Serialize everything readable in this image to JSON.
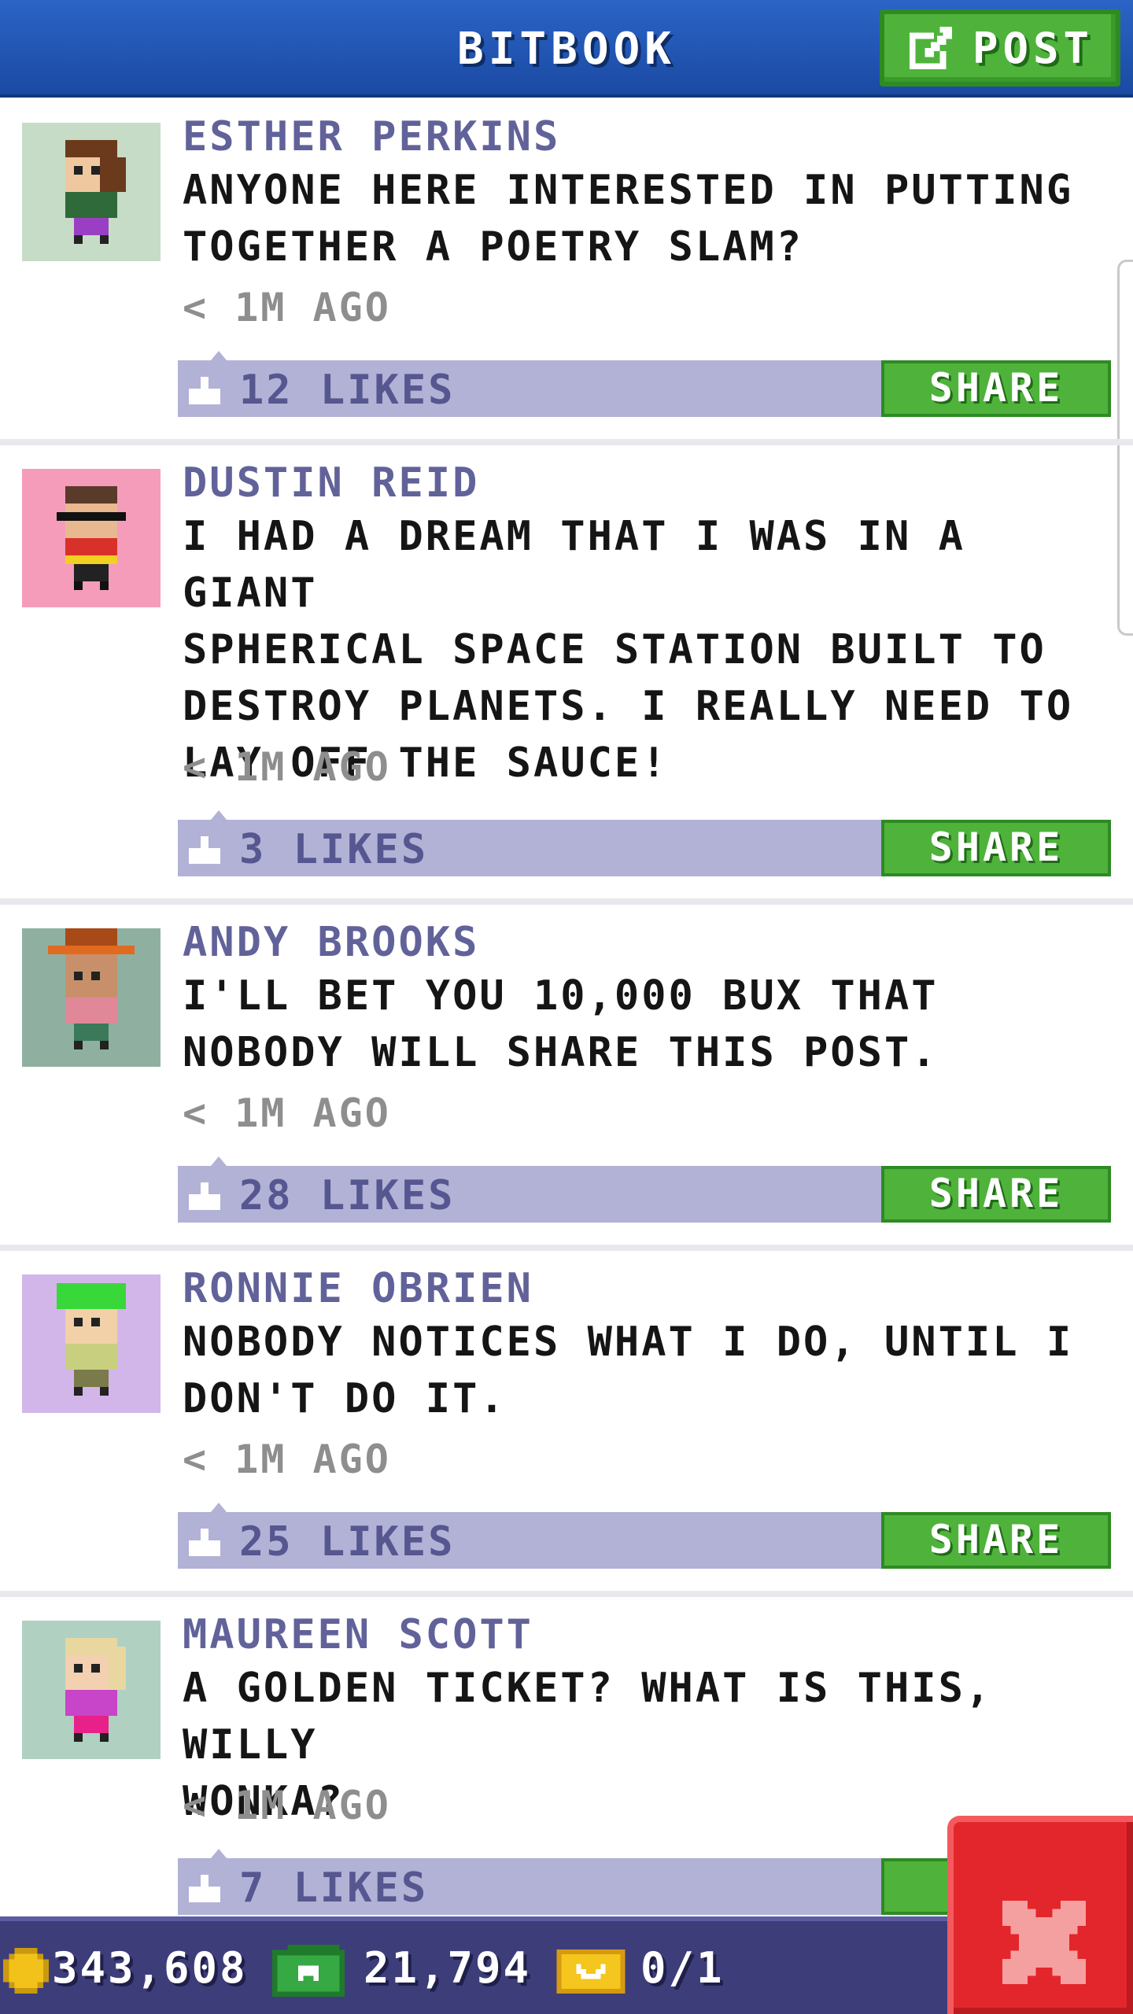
{
  "header": {
    "title": "BITBOOK",
    "post_label": "POST"
  },
  "posts": [
    {
      "name": "ESTHER PERKINS",
      "message": "ANYONE HERE INTERESTED IN PUTTING\nTOGETHER A POETRY SLAM?",
      "time": "< 1M AGO",
      "likes": "12 LIKES",
      "share": "SHARE"
    },
    {
      "name": "DUSTIN REID",
      "message": "I HAD A DREAM THAT I WAS IN A GIANT\nSPHERICAL SPACE STATION BUILT TO\nDESTROY PLANETS. I REALLY NEED TO\nLAY OFF THE SAUCE!",
      "time": "< 1M AGO",
      "likes": "3 LIKES",
      "share": "SHARE"
    },
    {
      "name": "ANDY BROOKS",
      "message": "I'LL BET YOU 10,000 BUX THAT\nNOBODY WILL SHARE THIS POST.",
      "time": "< 1M AGO",
      "likes": "28 LIKES",
      "share": "SHARE"
    },
    {
      "name": "RONNIE OBRIEN",
      "message": "NOBODY NOTICES WHAT I DO, UNTIL I\nDON'T DO IT.",
      "time": "< 1M AGO",
      "likes": "25 LIKES",
      "share": "SHARE"
    },
    {
      "name": "MAUREEN SCOTT",
      "message": "A GOLDEN TICKET? WHAT IS THIS, WILLY\nWONKA?",
      "time": "< 1M AGO",
      "likes": "7 LIKES",
      "share": "S"
    }
  ],
  "status": {
    "coins": "343,608",
    "bux": "21,794",
    "tickets": "0/1"
  },
  "icons": {
    "post": "edit-icon",
    "like": "thumbs-up-icon",
    "coin": "coin-icon",
    "bux": "bux-icon",
    "ticket": "golden-ticket-icon",
    "close": "close-icon"
  },
  "colors": {
    "topbar": "#1f55b4",
    "accent_green": "#4fb33b",
    "like_bar": "#b2b2d6",
    "name_text": "#62629a",
    "close_red": "#e3262b",
    "status_bar": "#3d3d7a"
  }
}
